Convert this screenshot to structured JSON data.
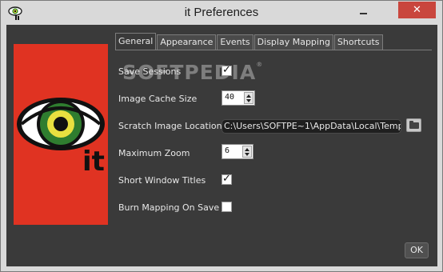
{
  "window": {
    "title": "it Preferences",
    "close_glyph": "✕",
    "app_icon": "eye-icon"
  },
  "logo": {
    "text": "it",
    "colors": {
      "background": "#e03322",
      "iris_outer": "#2f7d2f",
      "iris_inner": "#e8e040"
    }
  },
  "watermark": {
    "text": "SOFTPEDIA",
    "mark": "®"
  },
  "tabs": [
    {
      "label": "General",
      "active": true
    },
    {
      "label": "Appearance",
      "active": false
    },
    {
      "label": "Events",
      "active": false
    },
    {
      "label": "Display Mapping",
      "active": false
    },
    {
      "label": "Shortcuts",
      "active": false
    }
  ],
  "general": {
    "save_sessions": {
      "label": "Save Sessions",
      "checked": true
    },
    "image_cache_size": {
      "label": "Image Cache Size",
      "value": "40"
    },
    "scratch_location": {
      "label": "Scratch Image Location",
      "value": "C:\\Users\\SOFTPE~1\\AppData\\Local\\Temp",
      "browse_icon": "folder-icon"
    },
    "maximum_zoom": {
      "label": "Maximum Zoom",
      "value": "6"
    },
    "short_window_titles": {
      "label": "Short Window Titles",
      "checked": true
    },
    "burn_mapping": {
      "label": "Burn Mapping On Save",
      "checked": false
    }
  },
  "ok_label": "OK",
  "check_glyph": "✓"
}
